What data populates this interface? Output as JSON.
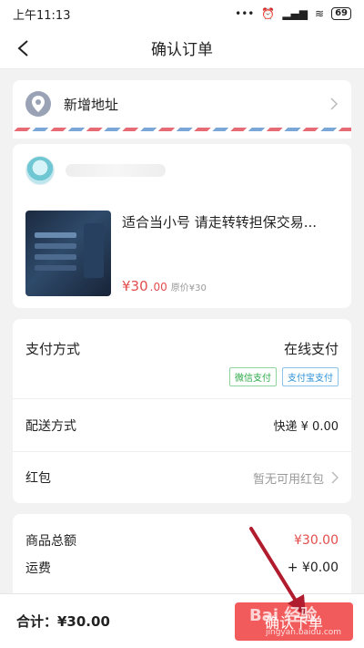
{
  "status_bar": {
    "time": "上午11:13",
    "signal": "📶",
    "battery": "69"
  },
  "nav": {
    "title": "确认订单"
  },
  "address": {
    "label": "新增地址"
  },
  "product": {
    "title": "适合当小号  请走转转担保交易...",
    "price": "¥30",
    "price_decimal": ".00",
    "original_price": "原价¥30"
  },
  "payment": {
    "label": "支付方式",
    "value": "在线支付",
    "tags": [
      "微信支付",
      "支付宝支付"
    ]
  },
  "delivery": {
    "label": "配送方式",
    "value": "快递 ¥ 0.00"
  },
  "red_packet": {
    "label": "红包",
    "value": "暂无可用红包"
  },
  "summary": {
    "goods_total_label": "商品总额",
    "goods_total_value": "¥30.00",
    "shipping_label": "运费",
    "shipping_value": "+ ¥0.00"
  },
  "footer": {
    "total": "合计：¥30.00",
    "submit_label": "确认下单"
  },
  "watermark": {
    "text": "Bai 经验",
    "sub": "jingyan.baidu.com"
  },
  "colors": {
    "accent_red": "#f15b5b",
    "price_red": "#e24d4d",
    "wechat_green": "#2aa846",
    "alipay_blue": "#2a8fd6"
  }
}
